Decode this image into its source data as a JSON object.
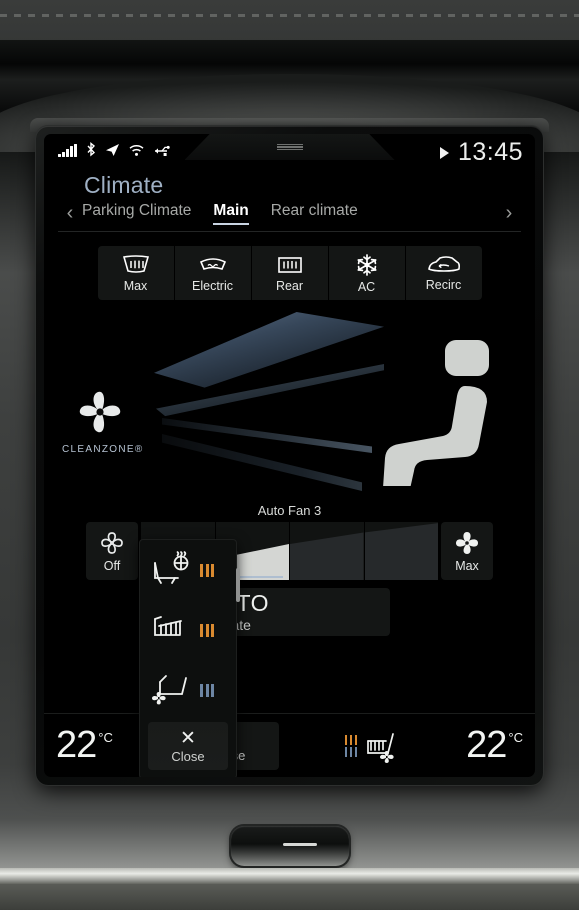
{
  "statusbar": {
    "icons": [
      "signal-bars-icon",
      "bluetooth-icon",
      "navigation-arrow-icon",
      "wifi-icon",
      "usb-icon"
    ],
    "handle": "pulldown-handle",
    "play_icon": "play-icon",
    "clock": "13:45"
  },
  "header": {
    "title": "Climate",
    "prev_arrow": "‹",
    "next_arrow": "›",
    "tabs": [
      {
        "label": "Parking Climate",
        "active": false
      },
      {
        "label": "Main",
        "active": true
      },
      {
        "label": "Rear climate",
        "active": false
      }
    ]
  },
  "function_buttons": [
    {
      "label": "Max",
      "icon": "max-defrost-icon"
    },
    {
      "label": "Electric",
      "icon": "electric-defrost-icon"
    },
    {
      "label": "Rear",
      "icon": "rear-defrost-icon"
    },
    {
      "label": "AC",
      "icon": "ac-snowflake-icon"
    },
    {
      "label": "Recirc",
      "icon": "recirculation-icon"
    }
  ],
  "graphic": {
    "brand_label": "CLEANZONE®",
    "fan_icon": "cleanzone-fan-icon",
    "seat_icon": "seat-silhouette-icon"
  },
  "fan": {
    "auto_label": "Auto Fan 3",
    "off_label": "Off",
    "off_icon": "fan-outline-icon",
    "max_label": "Max",
    "max_icon": "fan-solid-icon",
    "segments": [
      {
        "level": 1,
        "filled": true,
        "current": false
      },
      {
        "level": 2,
        "filled": true,
        "current": true
      },
      {
        "level": 3,
        "filled": false,
        "current": false
      },
      {
        "level": 4,
        "filled": false,
        "current": false
      }
    ]
  },
  "auto_climate": {
    "title": "AUTO",
    "subtitle": "Climate"
  },
  "bottom": {
    "left_temperature": "22",
    "left_unit": "°C",
    "right_temperature": "22",
    "right_unit": "°C",
    "close_label": "Close",
    "close_icon": "close-x-icon",
    "right_seat_icon": "seat-heat-vent-icon",
    "right_seat_heat_bars": 3,
    "right_seat_vent_bars": 3
  },
  "popup": {
    "items": [
      {
        "icon": "steering-wheel-heat-icon",
        "bars": 3,
        "color": "warm"
      },
      {
        "icon": "seat-heat-icon",
        "bars": 3,
        "color": "warm"
      },
      {
        "icon": "seat-ventilation-icon",
        "bars": 3,
        "color": "cool"
      }
    ],
    "close_label": "Close",
    "close_icon": "close-x-icon",
    "scrollbar": "popup-scrollbar"
  },
  "colors": {
    "accent_warm": "#d98a30",
    "accent_cool": "#6d86a4",
    "title_blue": "#9fb0c4",
    "panel": "#141615",
    "screen_bg": "#000000"
  }
}
